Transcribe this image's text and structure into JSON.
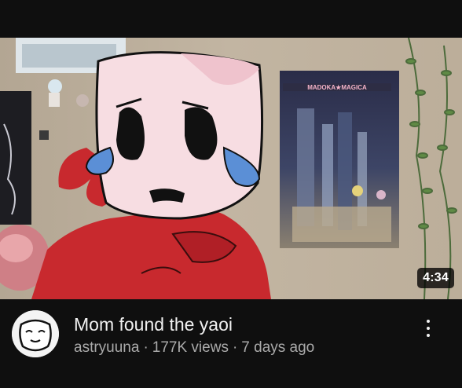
{
  "video": {
    "duration": "4:34",
    "title": "Mom found the yaoi",
    "channel": "astryuuna",
    "views": "177K views",
    "age": "7 days ago",
    "separator": "·"
  },
  "poster": {
    "text": "MADOKA★MAGICA"
  },
  "icons": {
    "avatar": "cartoon-face-avatar",
    "menu": "more-vert-icon"
  },
  "colors": {
    "background": "#0f0f0f",
    "title": "#f1f1f1",
    "subtext": "#aaaaaa",
    "duration_badge": "#000000"
  }
}
